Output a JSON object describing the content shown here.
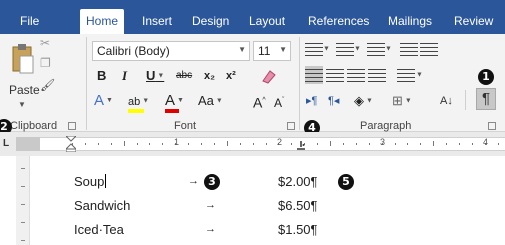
{
  "tabs": [
    {
      "label": "File",
      "active": false
    },
    {
      "label": "Home",
      "active": true
    },
    {
      "label": "Insert",
      "active": false
    },
    {
      "label": "Design",
      "active": false
    },
    {
      "label": "Layout",
      "active": false
    },
    {
      "label": "References",
      "active": false
    },
    {
      "label": "Mailings",
      "active": false
    },
    {
      "label": "Review",
      "active": false
    }
  ],
  "clipboard": {
    "paste_label": "Paste",
    "group_label": "Clipboard"
  },
  "font": {
    "family": "Calibri (Body)",
    "size": "11",
    "group_label": "Font",
    "bold": "B",
    "italic": "I",
    "underline": "U",
    "strike": "abc",
    "subscript": "x₂",
    "superscript": "x²",
    "text_a": "A",
    "change_case": "Aa",
    "grow": "A",
    "shrink": "A"
  },
  "paragraph": {
    "group_label": "Paragraph",
    "show_marks": "¶"
  },
  "callouts": [
    "1",
    "2",
    "3",
    "4",
    "5"
  ],
  "ruler": {
    "numbers": [
      "1",
      "2",
      "3",
      "4"
    ]
  },
  "document": {
    "rows": [
      {
        "item": "Soup",
        "price": "$2.00¶"
      },
      {
        "item": "Sandwich",
        "price": "$6.50¶"
      },
      {
        "item": "Iced·Tea",
        "price": "$1.50¶"
      }
    ],
    "tab_arrow": "→"
  },
  "colors": {
    "tab_bar": "#2b579a",
    "highlight": "#ffff00",
    "font_color": "#e00000"
  }
}
